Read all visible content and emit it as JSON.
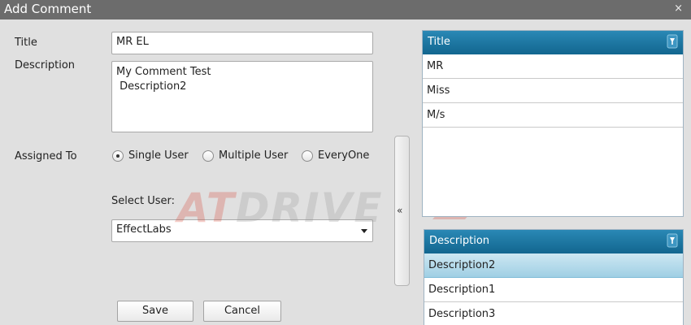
{
  "window": {
    "title": "Add Comment",
    "close_glyph": "×"
  },
  "form": {
    "title_label": "Title",
    "title_value": "MR EL",
    "description_label": "Description",
    "description_value": "My Comment Test\n Description2",
    "assigned_to_label": "Assigned To",
    "assigned_options": [
      {
        "label": "Single User",
        "selected": true
      },
      {
        "label": "Multiple User",
        "selected": false
      },
      {
        "label": "EveryOne",
        "selected": false
      }
    ],
    "select_user_label": "Select User:",
    "select_user_value": "EffectLabs"
  },
  "buttons": {
    "save": "Save",
    "cancel": "Cancel"
  },
  "splitter": {
    "glyph": "«"
  },
  "title_grid": {
    "header": "Title",
    "rows": [
      "MR",
      "Miss",
      "M/s"
    ]
  },
  "description_grid": {
    "header": "Description",
    "rows": [
      "Description2",
      "Description1",
      "Description3"
    ],
    "selected_index": 0
  },
  "watermark": {
    "part1": "AT",
    "part2": "DRIVE"
  },
  "colors": {
    "grid_header": "#1a75a3",
    "selected_row": "#add8ea",
    "titlebar": "#6c6c6c"
  }
}
